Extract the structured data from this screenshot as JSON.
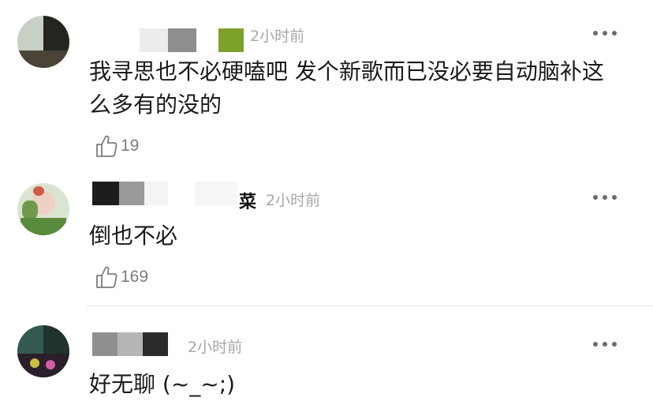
{
  "comments": [
    {
      "time": "2小时前",
      "text": "我寻思也不必硬嗑吧 发个新歌而已没必要自动脑补这么多有的没的",
      "likes": "19"
    },
    {
      "name_suffix": "菜",
      "time": "2小时前",
      "text": "倒也不必",
      "likes": "169"
    },
    {
      "time": "2小时前",
      "text": "好无聊 (~_~;)",
      "likes": ""
    }
  ],
  "icons": {
    "more": "more-dots-icon",
    "like": "thumbs-up-icon"
  },
  "colors": {
    "time": "#a6a6a6",
    "text": "#1a1a1a",
    "like_count": "#7d7d7d",
    "divider": "#e2e2e2"
  }
}
